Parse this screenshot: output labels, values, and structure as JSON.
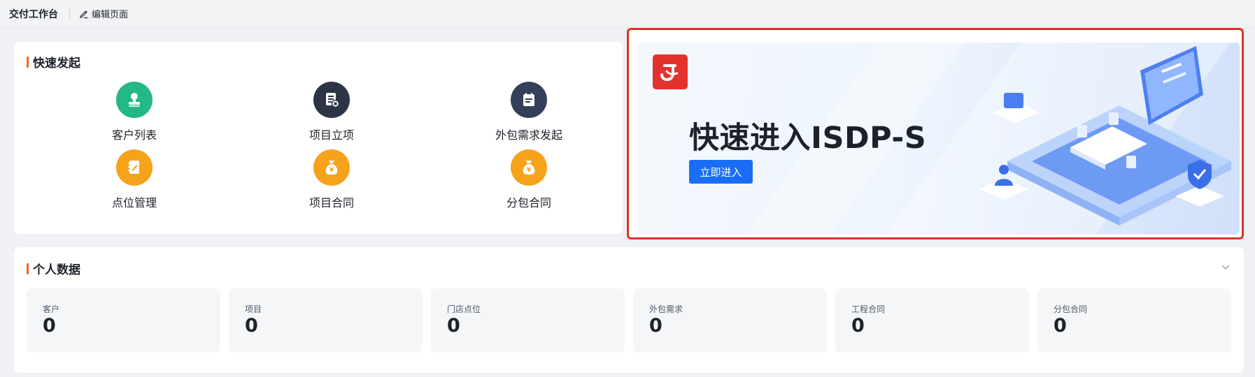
{
  "topbar": {
    "title": "交付工作台",
    "edit_label": "编辑页面"
  },
  "quick_start": {
    "title": "快速发起",
    "items": [
      {
        "label": "客户列表",
        "icon": "customer-icon",
        "color": "#23b884"
      },
      {
        "label": "项目立项",
        "icon": "project-setup-icon",
        "color": "#2c3445"
      },
      {
        "label": "外包需求发起",
        "icon": "outsource-request-icon",
        "color": "#34405a"
      },
      {
        "label": "点位管理",
        "icon": "location-management-icon",
        "color": "#f7a21b"
      },
      {
        "label": "项目合同",
        "icon": "money-bag-icon",
        "color": "#f7a21b"
      },
      {
        "label": "分包合同",
        "icon": "money-bag-icon",
        "color": "#f7a21b"
      }
    ]
  },
  "banner": {
    "headline": "快速进入ISDP-S",
    "button_label": "立即进入",
    "accent_color": "#1a6ef5",
    "logo_color": "#e5312c"
  },
  "personal_data": {
    "title": "个人数据",
    "stats": [
      {
        "label": "客户",
        "value": "0"
      },
      {
        "label": "项目",
        "value": "0"
      },
      {
        "label": "门店点位",
        "value": "0"
      },
      {
        "label": "外包需求",
        "value": "0"
      },
      {
        "label": "工程合同",
        "value": "0"
      },
      {
        "label": "分包合同",
        "value": "0"
      }
    ]
  }
}
